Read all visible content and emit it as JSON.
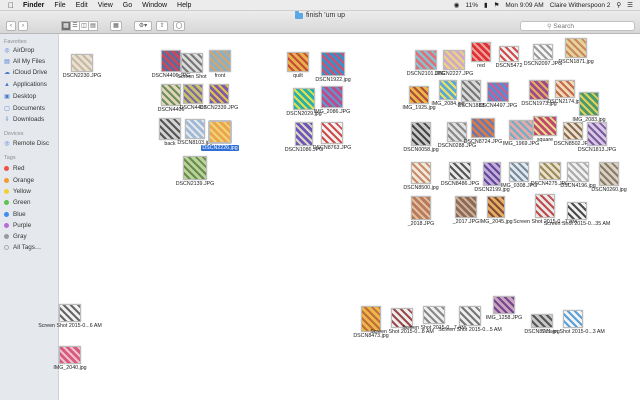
{
  "menubar": {
    "app": "Finder",
    "items": [
      "File",
      "Edit",
      "View",
      "Go",
      "Window",
      "Help"
    ],
    "battery": "11%",
    "clock": "Mon 9:09 AM",
    "user": "Claire Witherspoon 2"
  },
  "window": {
    "title": "finish 'um up",
    "search_placeholder": "Search"
  },
  "sidebar": {
    "favorites_header": "Favorites",
    "favorites": [
      "AirDrop",
      "All My Files",
      "iCloud Drive",
      "Applications",
      "Desktop",
      "Documents",
      "Downloads"
    ],
    "devices_header": "Devices",
    "devices": [
      "Remote Disc"
    ],
    "tags_header": "Tags",
    "tags": [
      {
        "name": "Red",
        "color": "#f0504b"
      },
      {
        "name": "Orange",
        "color": "#f49a33"
      },
      {
        "name": "Yellow",
        "color": "#f2cf36"
      },
      {
        "name": "Green",
        "color": "#5fc14f"
      },
      {
        "name": "Blue",
        "color": "#3d8ef0"
      },
      {
        "name": "Purple",
        "color": "#b46fd6"
      },
      {
        "name": "Gray",
        "color": "#9a9a9a"
      }
    ],
    "all_tags": "All Tags…"
  },
  "files": [
    {
      "label": "DSCN2230.JPG",
      "colors": [
        "#e8e1d3",
        "#c9b8a0"
      ]
    },
    {
      "label": "DSCN4406.JPG",
      "colors": [
        "#c84a5a",
        "#4b6fa8"
      ]
    },
    {
      "label": "Screen Shot",
      "colors": [
        "#dcdcdc",
        "#777"
      ]
    },
    {
      "label": "front",
      "colors": [
        "#8ab0c8",
        "#d7a46a"
      ]
    },
    {
      "label": "DSCN4406",
      "colors": [
        "#e2d4b8",
        "#6b8f5a"
      ]
    },
    {
      "label": "DSCN4402",
      "colors": [
        "#c9c06a",
        "#7a6aa3"
      ]
    },
    {
      "label": "DSCN2339.JPG",
      "colors": [
        "#7b5da8",
        "#e6c24a"
      ]
    },
    {
      "label": "back",
      "colors": [
        "#d2d2d2",
        "#555"
      ]
    },
    {
      "label": "DSCN8103.jpg",
      "colors": [
        "#9fbad8",
        "#e8e8e8"
      ]
    },
    {
      "label": "DSCN2226.jpg",
      "colors": [
        "#e9a64b",
        "#f3d27a"
      ],
      "selected": true
    },
    {
      "label": "DSCN2139.JPG",
      "colors": [
        "#b8d49a",
        "#6b8a4b"
      ]
    },
    {
      "label": "quilt",
      "colors": [
        "#e8b04a",
        "#c44a3a"
      ]
    },
    {
      "label": "DSCN1922.jpg",
      "colors": [
        "#3a8fc9",
        "#d84b6a"
      ]
    },
    {
      "label": "DSCN2029.jpg",
      "colors": [
        "#2ab0a8",
        "#e4e04a"
      ]
    },
    {
      "label": "IMG_2086.JPG",
      "colors": [
        "#c24a88",
        "#5a9ad0"
      ]
    },
    {
      "label": "DSCN1086.JPG",
      "colors": [
        "#6a58b8",
        "#e3d6c4"
      ]
    },
    {
      "label": "DSCN8763.JPG",
      "colors": [
        "#f2f2f2",
        "#d04a4a"
      ]
    },
    {
      "label": "DSCN2101.JPG",
      "colors": [
        "#e0707a",
        "#7acbd8"
      ]
    },
    {
      "label": "DSCN2227.JPG",
      "colors": [
        "#d3a8c8",
        "#e8d87a"
      ]
    },
    {
      "label": "red",
      "colors": [
        "#d33",
        "#f0a0a0"
      ]
    },
    {
      "label": "DSCN5472",
      "colors": [
        "#efefef",
        "#d04a4a"
      ]
    },
    {
      "label": "DSCN2097.JPG",
      "colors": [
        "#f5f5f5",
        "#999"
      ]
    },
    {
      "label": "DSCN1871.jpg",
      "colors": [
        "#e6d2a0",
        "#c88a5a"
      ]
    },
    {
      "label": "IMG_1925.jpg",
      "colors": [
        "#e9b84a",
        "#b04a3a"
      ]
    },
    {
      "label": "IMG_2084.jpg",
      "colors": [
        "#58a8d8",
        "#f0e060"
      ]
    },
    {
      "label": "DSCN1883",
      "colors": [
        "#d9d9d9",
        "#777"
      ]
    },
    {
      "label": "DSCN4497.JPG",
      "colors": [
        "#5a8ad0",
        "#d05a8a"
      ]
    },
    {
      "label": "DSCN1973.jpg",
      "colors": [
        "#a14a8a",
        "#e0b060"
      ]
    },
    {
      "label": "DSCN2174.jpg",
      "colors": [
        "#f0d8b8",
        "#c06a4a"
      ]
    },
    {
      "label": "IMG_2083.jpg",
      "colors": [
        "#4a9a6a",
        "#e0d060"
      ]
    },
    {
      "label": "DSCN0058.jpg",
      "colors": [
        "#c8c8c8",
        "#444"
      ]
    },
    {
      "label": "DSCN0288.JPG",
      "colors": [
        "#e0e0e0",
        "#888"
      ]
    },
    {
      "label": "DSCN8724.JPG",
      "colors": [
        "#d87a4a",
        "#5a7ac0"
      ]
    },
    {
      "label": "IMG_1969.JPG",
      "colors": [
        "#e8a8a8",
        "#6ab0c8"
      ]
    },
    {
      "label": "square",
      "colors": [
        "#c04a6a",
        "#e8d890"
      ]
    },
    {
      "label": "DSCN8502.JPG",
      "colors": [
        "#e8e0d0",
        "#8a6a4a"
      ]
    },
    {
      "label": "DSCN1813.JPG",
      "colors": [
        "#d8c8e8",
        "#7a5a9a"
      ]
    },
    {
      "label": "DSCN8500.jpg",
      "colors": [
        "#f0e8d8",
        "#c88a6a"
      ]
    },
    {
      "label": "DSCN8486.JPG",
      "colors": [
        "#e8e8e8",
        "#555"
      ]
    },
    {
      "label": "DSCN2199.jpg",
      "colors": [
        "#c9a9d8",
        "#5a4a9a"
      ]
    },
    {
      "label": "IMG_0308.JPG",
      "colors": [
        "#e0e8f0",
        "#7a8a9a"
      ]
    },
    {
      "label": "DSCN4275.JPG",
      "colors": [
        "#e8e0c8",
        "#9a8a5a"
      ]
    },
    {
      "label": "DSCN4196.jpg",
      "colors": [
        "#f0f0f0",
        "#aaa"
      ]
    },
    {
      "label": "DSCN0260.jpg",
      "colors": [
        "#d8d0c0",
        "#8a7a6a"
      ]
    },
    {
      "label": "_2018.JPG",
      "colors": [
        "#b87a5a",
        "#e0c0a0"
      ]
    },
    {
      "label": "_2017.JPG",
      "colors": [
        "#8a6a5a",
        "#d0b090"
      ]
    },
    {
      "label": "IMG_2045.jpg",
      "colors": [
        "#e0b060",
        "#8a4a3a"
      ]
    },
    {
      "label": "Screen Shot 2015-0...7 AM",
      "colors": [
        "#e8e8e8",
        "#c04a4a"
      ]
    },
    {
      "label": "Screen Shot 2015-0...35 AM",
      "colors": [
        "#f0f0f0",
        "#4a4a4a"
      ]
    },
    {
      "label": "Screen Shot 2015-0...6 AM",
      "colors": [
        "#f0f0f0",
        "#666"
      ]
    },
    {
      "label": "IMG_2040.jpg",
      "colors": [
        "#d85a7a",
        "#f0c0d0"
      ]
    },
    {
      "label": "DSCN8473.jpg",
      "colors": [
        "#e8b84a",
        "#c46a3a"
      ]
    },
    {
      "label": "Screen Shot 2015-0...8 AM",
      "colors": [
        "#eee",
        "#9a4a4a"
      ]
    },
    {
      "label": "Screen Shot 2015-0...7 AM",
      "colors": [
        "#eee",
        "#888"
      ]
    },
    {
      "label": "Screen Shot 2015-0...5 AM",
      "colors": [
        "#eee",
        "#777"
      ]
    },
    {
      "label": "IMG_1258.JPG",
      "colors": [
        "#d0a0c0",
        "#6a4a8a"
      ]
    },
    {
      "label": "DSCN8771.jpg",
      "colors": [
        "#c8c8c8",
        "#555"
      ]
    },
    {
      "label": "Screen Shot 2015-0...3 AM",
      "colors": [
        "#f4f4f4",
        "#5aa0d8"
      ]
    }
  ]
}
